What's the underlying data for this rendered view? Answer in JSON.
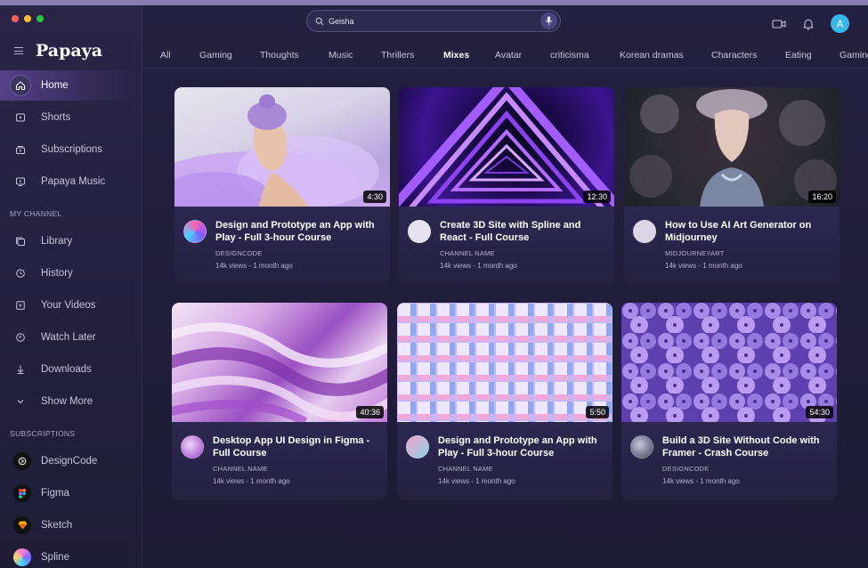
{
  "app": {
    "name": "Papaya"
  },
  "search": {
    "value": "Geisha"
  },
  "header": {
    "avatar_initial": "A"
  },
  "sidebar": {
    "main_items": [
      {
        "label": "Home",
        "icon": "home-icon",
        "active": true
      },
      {
        "label": "Shorts",
        "icon": "play-icon"
      },
      {
        "label": "Subscriptions",
        "icon": "subscriptions-icon"
      },
      {
        "label": "Papaya Music",
        "icon": "music-icon"
      }
    ],
    "my_channel_label": "MY CHANNEL",
    "channel_items": [
      {
        "label": "Library",
        "icon": "library-icon"
      },
      {
        "label": "History",
        "icon": "history-icon"
      },
      {
        "label": "Your Videos",
        "icon": "video-icon"
      },
      {
        "label": "Watch Later",
        "icon": "clock-icon"
      },
      {
        "label": "Downloads",
        "icon": "download-icon"
      },
      {
        "label": "Show More",
        "icon": "chevron-down-icon"
      }
    ],
    "subscriptions_label": "SUBSCRIPTIONS",
    "subscriptions": [
      {
        "label": "DesignCode",
        "color": "#1c1c1c"
      },
      {
        "label": "Figma",
        "color": "#1e1e1e"
      },
      {
        "label": "Sketch",
        "color": "#1a1a1a"
      },
      {
        "label": "Spline",
        "color": "#6f7bf5"
      }
    ]
  },
  "chips": [
    "All",
    "Gaming",
    "Thoughts",
    "Music",
    "Thrillers",
    "Mixes",
    "Avatar",
    "criticisma",
    "Korean dramas",
    "Characters",
    "Eating",
    "Gaming"
  ],
  "active_chip": "Mixes",
  "videos": [
    {
      "title": "Design and Prototype an App with Play - Full 3-hour Course",
      "channel": "DESIGNCODE",
      "meta": "14k views - 1 month ago",
      "duration": "4:30"
    },
    {
      "title": "Create 3D Site with Spline and React - Full Course",
      "channel": "CHANNEL NAME",
      "meta": "14k views - 1 month ago",
      "duration": "12:30"
    },
    {
      "title": "How to Use AI Art Generator on Midjourney",
      "channel": "MIDJOURNEYART",
      "meta": "14k views - 1 month ago",
      "duration": "16:20"
    },
    {
      "title": "Desktop App UI Design in Figma - Full Course",
      "channel": "CHANNEL NAME",
      "meta": "14k views - 1 month ago",
      "duration": "40:36"
    },
    {
      "title": "Design and Prototype an App with Play - Full 3-hour Course",
      "channel": "CHANNEL NAME",
      "meta": "14k views - 1 month ago",
      "duration": "5:50"
    },
    {
      "title": "Build a 3D Site Without Code with Framer - Crash Course",
      "channel": "DESIGNCODE",
      "meta": "14k views - 1 month ago",
      "duration": "54:30"
    }
  ],
  "colors": {
    "accent": "#8a5cf6",
    "avatar": "#36b7e9",
    "background": "#211d3a"
  }
}
